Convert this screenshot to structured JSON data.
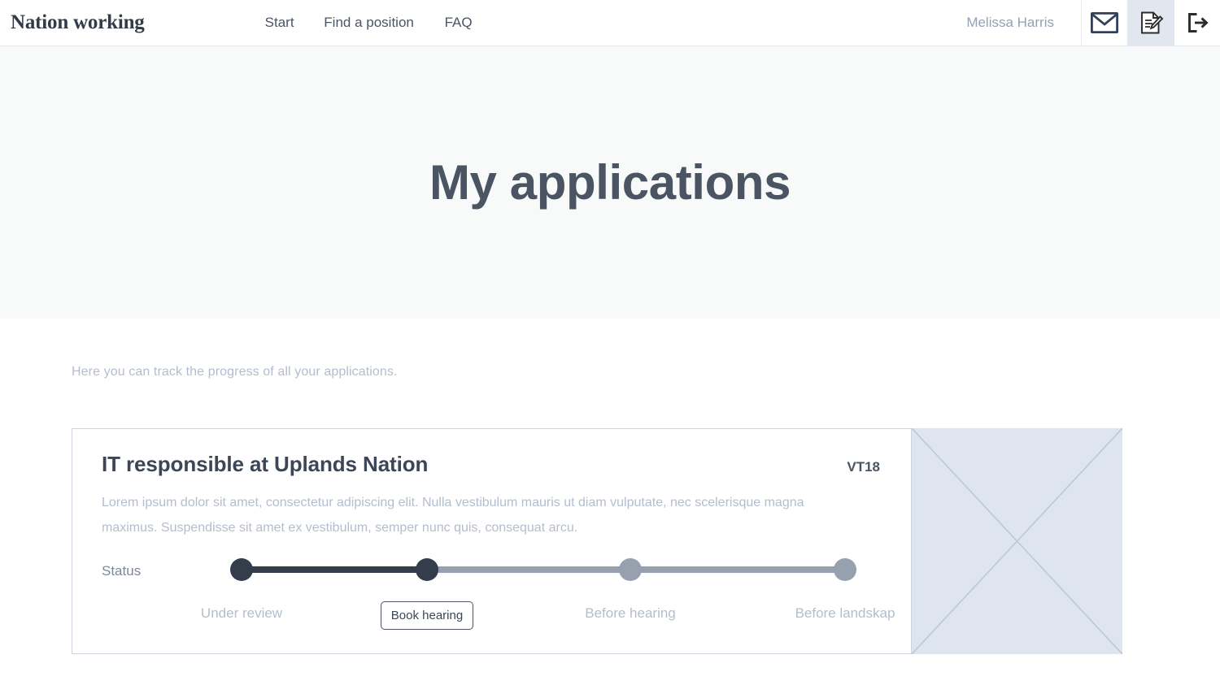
{
  "header": {
    "brand": "Nation working",
    "nav": [
      {
        "label": "Start",
        "name": "nav-item-start"
      },
      {
        "label": "Find a position",
        "name": "nav-item-find-a-position"
      },
      {
        "label": "FAQ",
        "name": "nav-item-faq"
      }
    ],
    "user_name": "Melissa Harris",
    "icons": [
      {
        "name": "mail-icon",
        "label": "mail-icon",
        "active": false
      },
      {
        "name": "applications-document-pen-icon",
        "label": "applications-icon",
        "active": true
      },
      {
        "name": "logout-icon",
        "label": "logout-icon",
        "active": false
      }
    ]
  },
  "hero": {
    "title": "My applications"
  },
  "main": {
    "intro": "Here you can track the progress of all your applications.",
    "applications": [
      {
        "title": "IT responsible at Uplands Nation",
        "badge": "VT18",
        "description": "Lorem ipsum dolor sit amet, consectetur adipiscing elit. Nulla vestibulum mauris ut diam vulputate, nec scelerisque magna maximus. Suspendisse sit amet ex vestibulum, semper nunc quis, consequat arcu.",
        "status_label": "Status",
        "steps": [
          {
            "label": "Under review",
            "state": "done",
            "type": "label"
          },
          {
            "label": "Book hearing",
            "state": "done",
            "type": "button"
          },
          {
            "label": "Before hearing",
            "state": "todo",
            "type": "label"
          },
          {
            "label": "Before landskap",
            "state": "todo",
            "type": "label"
          }
        ],
        "thumbnail": "image-placeholder"
      }
    ]
  },
  "colors": {
    "text_dark": "#3c4656",
    "text_muted": "#b4bdcd",
    "step_done": "#333d4c",
    "step_todo": "#97a0ae",
    "hero_bg": "#f8f9f9",
    "card_border": "#ccd4e0",
    "thumb_bg": "#dfe5ee",
    "icon_active_bg": "#e1e6ef"
  }
}
